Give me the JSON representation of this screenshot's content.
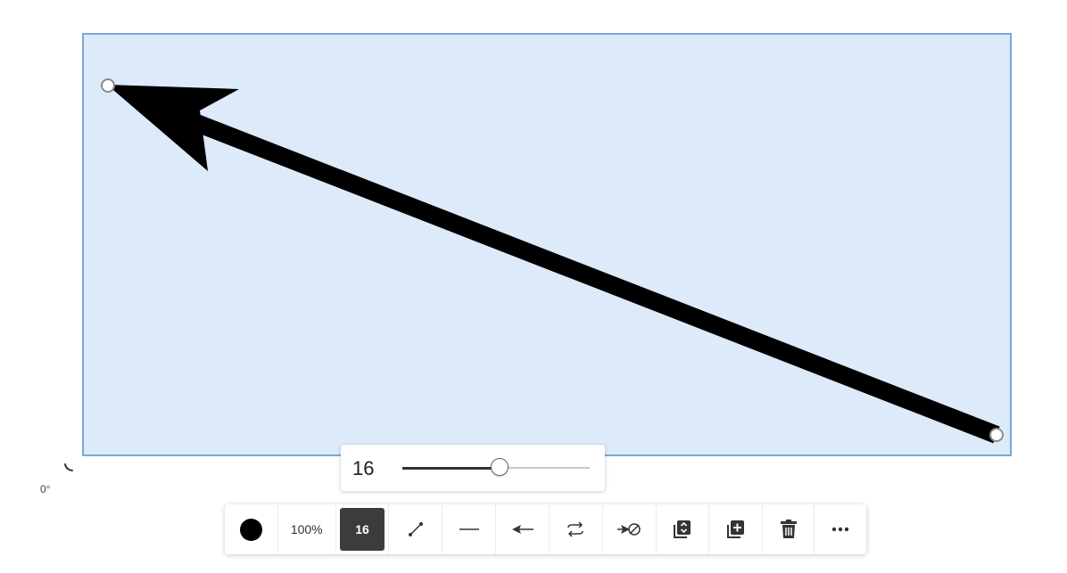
{
  "canvas": {
    "rotation_label": "0°",
    "selection_color": "#ddeafa",
    "selection_border_color": "#7aa7dc",
    "arrow_color": "#000000"
  },
  "size_popup": {
    "value": "16",
    "slider_fraction": 0.52
  },
  "toolbar": {
    "color_swatch": "#000000",
    "opacity_label": "100%",
    "size_label": "16",
    "icons": [
      "line-style-icon",
      "line-dash-icon",
      "arrow-start-icon",
      "swap-direction-icon",
      "arrow-end-icon",
      "layer-order-icon",
      "duplicate-icon",
      "trash-icon",
      "more-icon"
    ]
  }
}
